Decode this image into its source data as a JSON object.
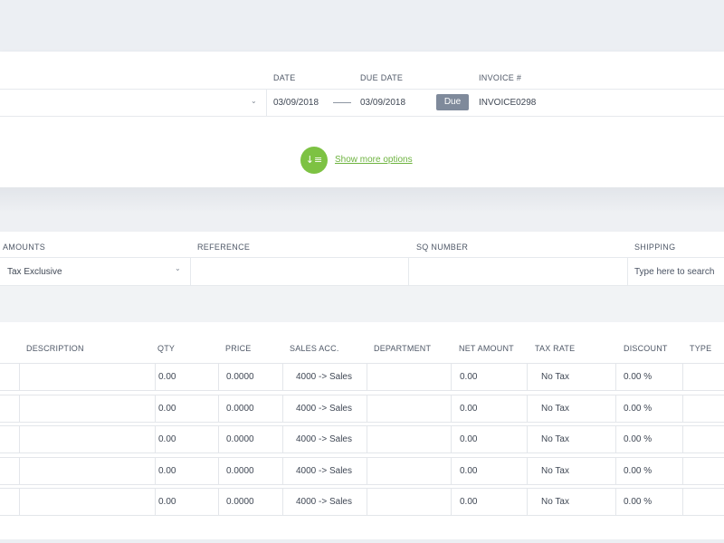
{
  "header": {
    "date_label": "DATE",
    "due_date_label": "DUE DATE",
    "invoice_label": "INVOICE #",
    "date_value": "03/09/2018",
    "due_date_value": "03/09/2018",
    "status_badge": "Due",
    "invoice_number": "INVOICE0298",
    "more_icon_glyph": "↓≡",
    "more_options_label": "Show more options"
  },
  "options": {
    "amounts_label": "AMOUNTS",
    "reference_label": "REFERENCE",
    "sq_number_label": "SQ NUMBER",
    "shipping_label": "SHIPPING",
    "amounts_value": "Tax Exclusive",
    "reference_value": "",
    "sq_number_value": "",
    "shipping_placeholder": "Type here to search"
  },
  "lines": {
    "columns": [
      "DESCRIPTION",
      "QTY",
      "PRICE",
      "SALES ACC.",
      "DEPARTMENT",
      "NET AMOUNT",
      "TAX RATE",
      "DISCOUNT",
      "TYPE"
    ],
    "rows": [
      {
        "description": "",
        "qty": "0.00",
        "price": "0.0000",
        "sales_acc": "4000 -> Sales",
        "department": "",
        "net_amount": "0.00",
        "tax_rate": "No Tax",
        "discount": "0.00 %",
        "type": ""
      },
      {
        "description": "",
        "qty": "0.00",
        "price": "0.0000",
        "sales_acc": "4000 -> Sales",
        "department": "",
        "net_amount": "0.00",
        "tax_rate": "No Tax",
        "discount": "0.00 %",
        "type": ""
      },
      {
        "description": "",
        "qty": "0.00",
        "price": "0.0000",
        "sales_acc": "4000 -> Sales",
        "department": "",
        "net_amount": "0.00",
        "tax_rate": "No Tax",
        "discount": "0.00 %",
        "type": ""
      },
      {
        "description": "",
        "qty": "0.00",
        "price": "0.0000",
        "sales_acc": "4000 -> Sales",
        "department": "",
        "net_amount": "0.00",
        "tax_rate": "No Tax",
        "discount": "0.00 %",
        "type": ""
      },
      {
        "description": "",
        "qty": "0.00",
        "price": "0.0000",
        "sales_acc": "4000 -> Sales",
        "department": "",
        "net_amount": "0.00",
        "tax_rate": "No Tax",
        "discount": "0.00 %",
        "type": ""
      }
    ]
  },
  "colors": {
    "accent_green": "#7dc243",
    "link_green": "#6db33f",
    "badge_gray": "#7f8a9b"
  },
  "icons": {
    "customer_dropdown": "chevron-down-icon",
    "amounts_dropdown": "chevron-down-icon",
    "more_options": "sort-list-icon"
  }
}
